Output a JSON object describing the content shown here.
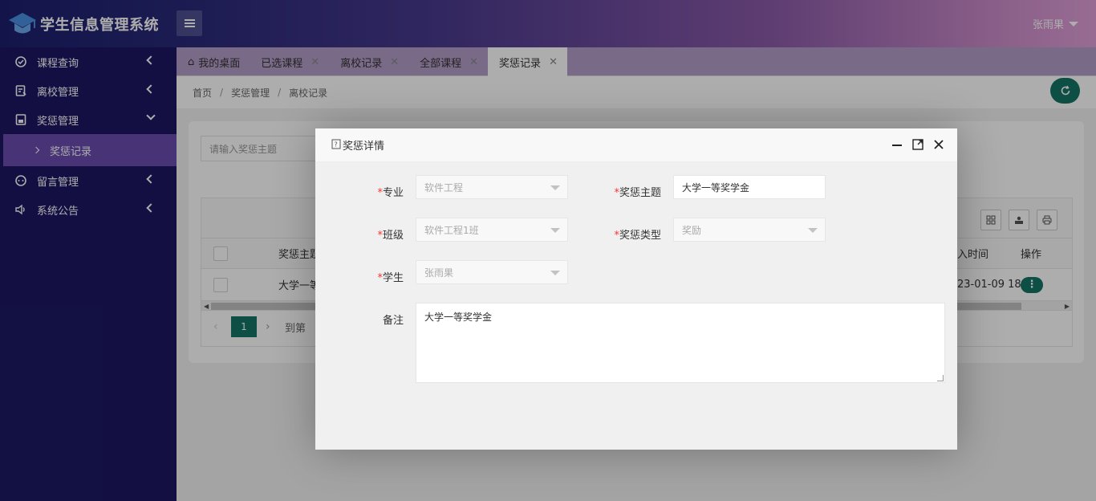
{
  "app": {
    "title": "学生信息管理系统",
    "user": "张雨果"
  },
  "sidebar": {
    "items": [
      {
        "label": "课程查询",
        "icon": "check-circle-icon"
      },
      {
        "label": "离校管理",
        "icon": "form-icon"
      },
      {
        "label": "奖惩管理",
        "icon": "record-icon"
      },
      {
        "label": "留言管理",
        "icon": "chat-icon"
      },
      {
        "label": "系统公告",
        "icon": "speaker-icon"
      }
    ],
    "sub_item": "奖惩记录"
  },
  "tabs": [
    {
      "label": "我的桌面"
    },
    {
      "label": "已选课程"
    },
    {
      "label": "离校记录"
    },
    {
      "label": "全部课程"
    },
    {
      "label": "奖惩记录"
    }
  ],
  "breadcrumb": {
    "home": "首页",
    "section": "奖惩管理",
    "page": "离校记录"
  },
  "content": {
    "search_placeholder": "请输入奖惩主题",
    "table": {
      "col_topic": "奖惩主题",
      "col_time": "入时间",
      "col_action": "操作",
      "row": {
        "topic": "大学一等",
        "time": "23-01-09 18"
      }
    },
    "pager": {
      "current": "1",
      "goto": "到第"
    }
  },
  "modal": {
    "title": "奖惩详情",
    "fields": {
      "major_label": "专业",
      "major_value": "软件工程",
      "topic_label": "奖惩主题",
      "topic_value": "大学一等奖学金",
      "class_label": "班级",
      "class_value": "软件工程1班",
      "type_label": "奖惩类型",
      "type_value": "奖励",
      "student_label": "学生",
      "student_value": "张雨果",
      "note_label": "备注",
      "note_value": "大学一等奖学金"
    }
  },
  "colors": {
    "primary": "#147565",
    "sidebar": "#1c1764",
    "active_sub": "#6a4cb0"
  }
}
